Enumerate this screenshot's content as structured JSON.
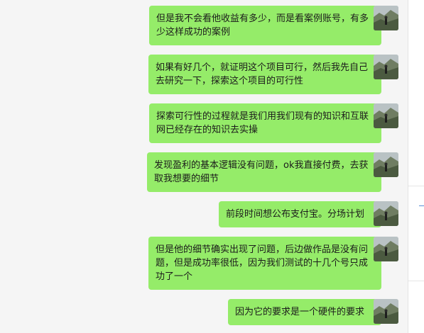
{
  "messages": [
    {
      "text": "但是我不会看他收益有多少，而是看案例账号，有多少这样成功的案例"
    },
    {
      "text": "如果有好几个，就证明这个项目可行，然后我先自己去研究一下，探索这个项目的可行性"
    },
    {
      "text": "探索可行性的过程就是我们用我们现有的知识和互联网已经存在的知识去实操"
    },
    {
      "text": "发现盈利的基本逻辑没有问题，ok我直接付费，去获取我想要的细节"
    },
    {
      "text": "前段时间想公布支付宝。分场计划"
    },
    {
      "text": "但是他的细节确实出现了问题，后边做作品是没有问题，但是成功率很低，因为我们测试的十几个号只成功了一个"
    },
    {
      "text": "因为它的要求是一个硬件的要求"
    }
  ],
  "colors": {
    "bubble": "#95ec69",
    "background": "#f5f5f5"
  }
}
